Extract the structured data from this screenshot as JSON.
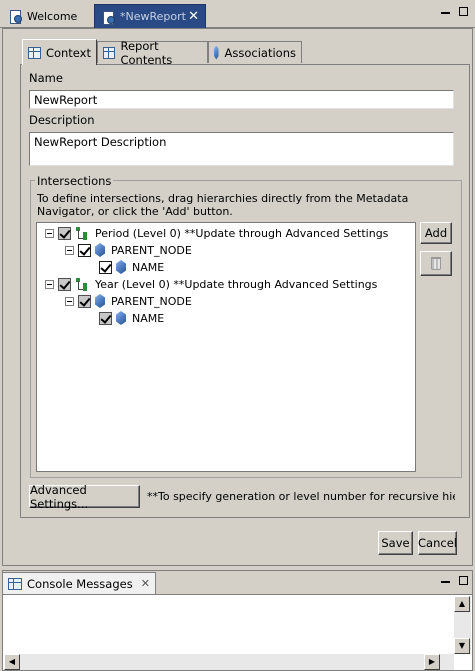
{
  "editor_tabs": {
    "welcome_label": "Welcome",
    "active_label": "*NewReport",
    "close_glyph": "✕"
  },
  "sub_tabs": [
    {
      "label": "Context",
      "icon": "table-icon"
    },
    {
      "label": "Report Contents",
      "icon": "table-icon"
    },
    {
      "label": "Associations",
      "icon": "cube-icon"
    }
  ],
  "form": {
    "name_label": "Name",
    "name_value": "NewReport",
    "description_label": "Description",
    "description_value": "NewReport Description"
  },
  "intersections": {
    "title": "Intersections",
    "hint": "To define intersections, drag hierarchies directly from the Metadata Navigator, or click the 'Add' button.",
    "add_label": "Add",
    "tree": [
      {
        "label": "Period (Level 0) **Update through Advanced Settings",
        "level": 0,
        "type": "hierarchy",
        "checked": "partial"
      },
      {
        "label": "PARENT_NODE",
        "level": 1,
        "type": "member",
        "checked": "checked"
      },
      {
        "label": "NAME",
        "level": 2,
        "type": "member",
        "checked": "checked"
      },
      {
        "label": "Year (Level 0) **Update through Advanced Settings",
        "level": 0,
        "type": "hierarchy",
        "checked": "partial"
      },
      {
        "label": "PARENT_NODE",
        "level": 1,
        "type": "member",
        "checked": "partial"
      },
      {
        "label": "NAME",
        "level": 2,
        "type": "member",
        "checked": "partial"
      }
    ]
  },
  "advanced": {
    "button_label": "Advanced Settings...",
    "note": "**To specify generation or level number for recursive hierarchie"
  },
  "actions": {
    "save_label": "Save",
    "cancel_label": "Cancel"
  },
  "console": {
    "tab_label": "Console Messages",
    "close_glyph": "✕"
  },
  "colors": {
    "active_tab_bg": "#2a4a86",
    "window_bg": "#d4d0c8",
    "hierarchy_icon": "#2c8c3c",
    "member_icon": "#4f7fc3"
  }
}
